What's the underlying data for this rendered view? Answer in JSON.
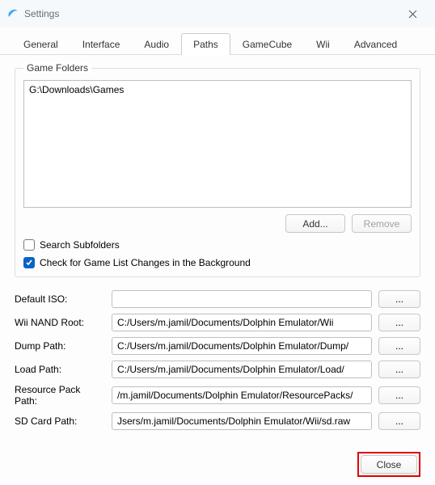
{
  "window": {
    "title": "Settings"
  },
  "tabs": {
    "general": "General",
    "interface": "Interface",
    "audio": "Audio",
    "paths": "Paths",
    "gamecube": "GameCube",
    "wii": "Wii",
    "advanced": "Advanced",
    "active": "paths"
  },
  "gameFolders": {
    "legend": "Game Folders",
    "items": [
      "G:\\Downloads\\Games"
    ],
    "addLabel": "Add...",
    "removeLabel": "Remove"
  },
  "checks": {
    "searchSubfolders": {
      "label": "Search Subfolders",
      "checked": false
    },
    "backgroundCheck": {
      "label": "Check for Game List Changes in the Background",
      "checked": true
    }
  },
  "paths": {
    "defaultIso": {
      "label": "Default ISO:",
      "value": ""
    },
    "wiiNand": {
      "label": "Wii NAND Root:",
      "value": "C:/Users/m.jamil/Documents/Dolphin Emulator/Wii"
    },
    "dump": {
      "label": "Dump Path:",
      "value": "C:/Users/m.jamil/Documents/Dolphin Emulator/Dump/"
    },
    "load": {
      "label": "Load Path:",
      "value": "C:/Users/m.jamil/Documents/Dolphin Emulator/Load/"
    },
    "resource": {
      "label": "Resource Pack Path:",
      "value": "/m.jamil/Documents/Dolphin Emulator/ResourcePacks/"
    },
    "sdcard": {
      "label": "SD Card Path:",
      "value": "Jsers/m.jamil/Documents/Dolphin Emulator/Wii/sd.raw"
    },
    "browseLabel": "..."
  },
  "footer": {
    "closeLabel": "Close"
  }
}
